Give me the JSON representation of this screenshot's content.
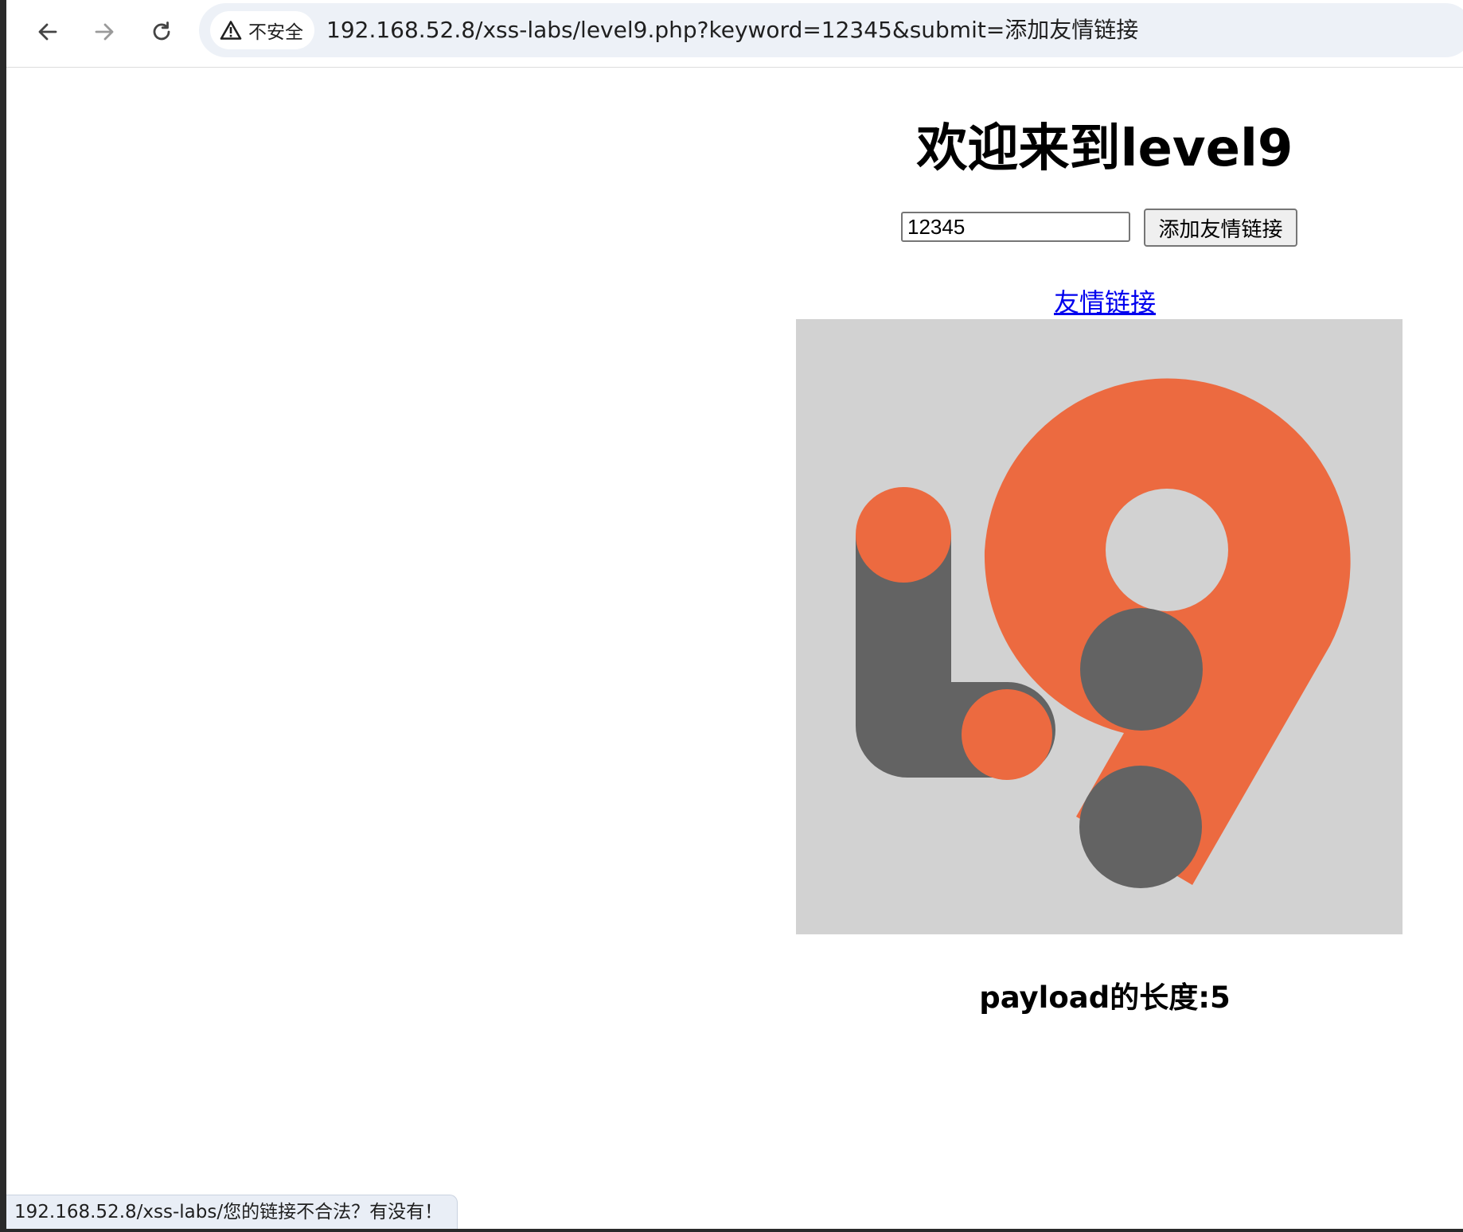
{
  "browser": {
    "security_label": "不安全",
    "url": "192.168.52.8/xss-labs/level9.php?keyword=12345&submit=添加友情链接",
    "status_url": "192.168.52.8/xss-labs/您的链接不合法？有没有！"
  },
  "page": {
    "title": "欢迎来到level9",
    "keyword_value": "12345",
    "submit_label": "添加友情链接",
    "link_label": "友情链接",
    "payload_length_text": "payload的长度:5"
  },
  "logo": {
    "label": "L9",
    "colors": {
      "background": "#d2d2d2",
      "orange": "#ec6a40",
      "gray": "#636363"
    }
  },
  "icons": {
    "back": "back-arrow-icon",
    "forward": "forward-arrow-icon",
    "reload": "reload-icon",
    "warning": "warning-icon"
  }
}
